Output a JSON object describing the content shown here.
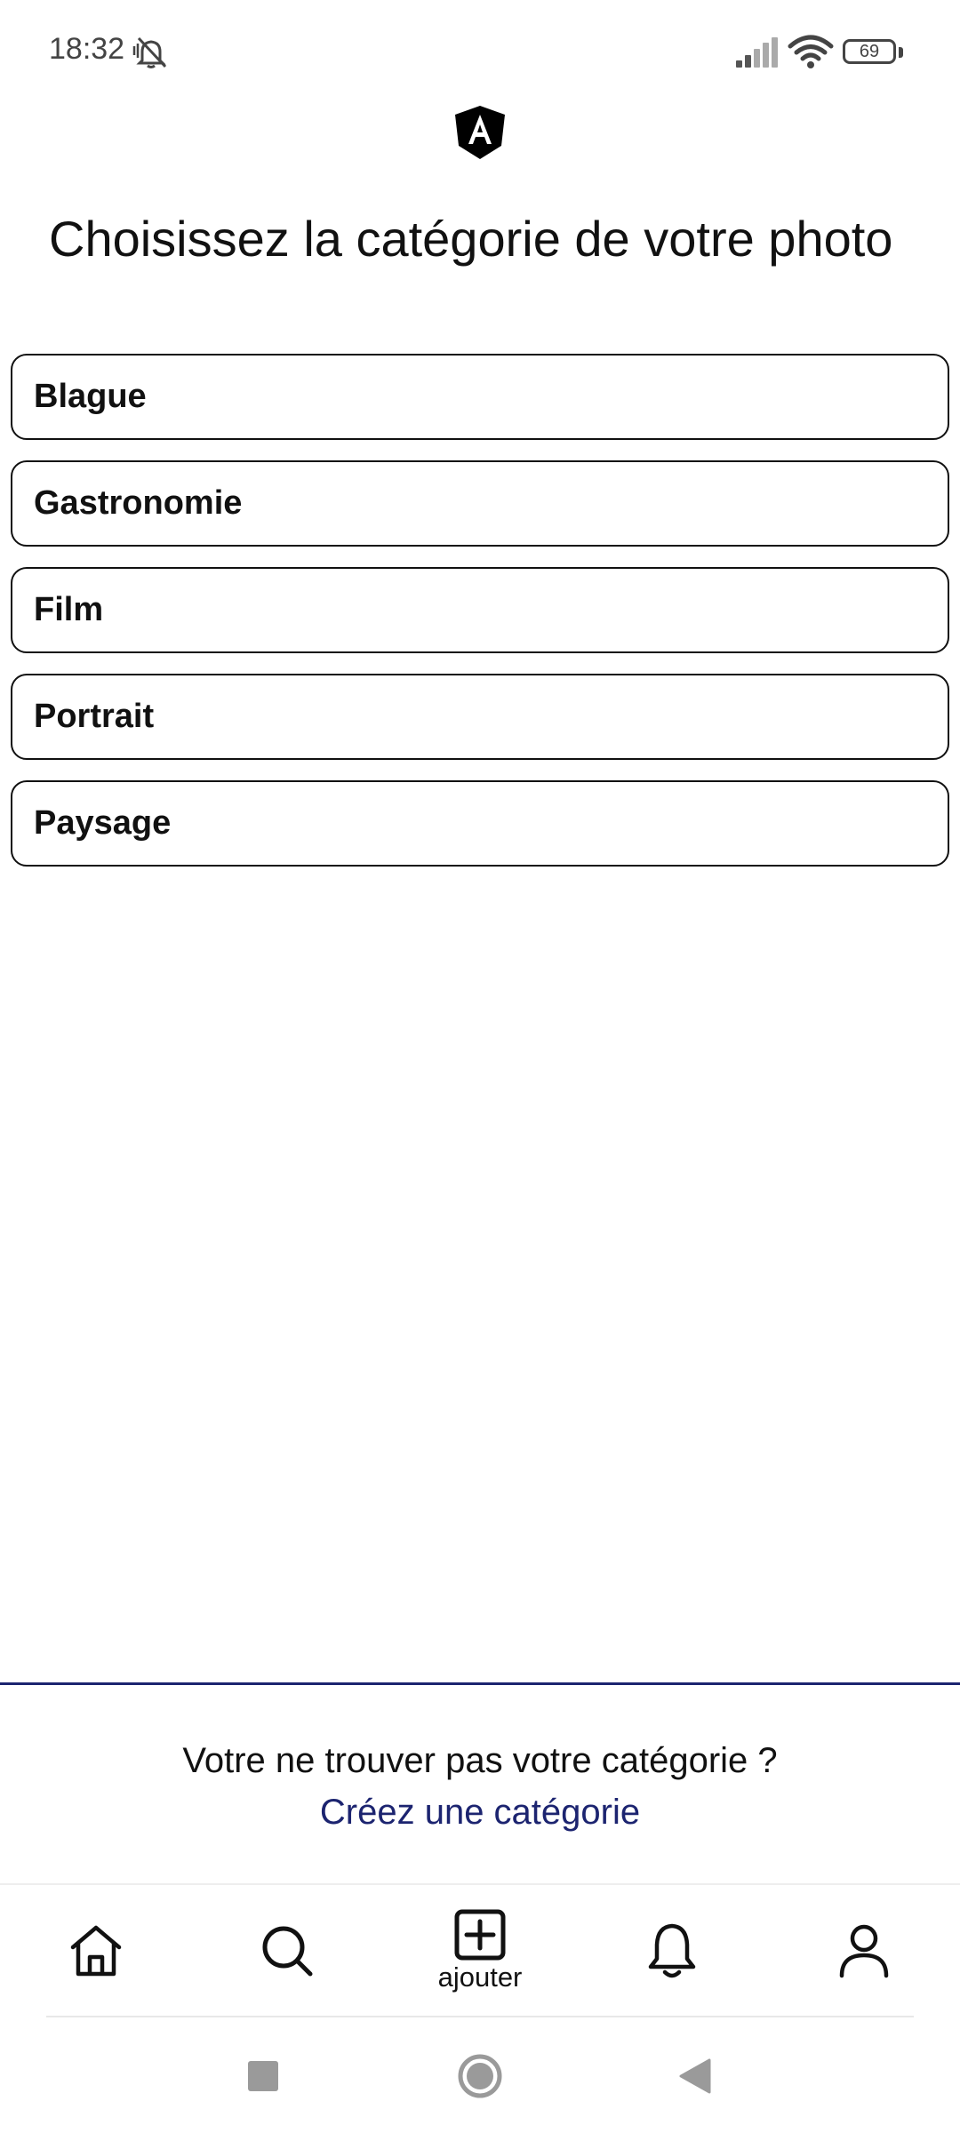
{
  "status_bar": {
    "time": "18:32",
    "battery_level": "69",
    "icons": [
      "mute-icon",
      "signal-icon",
      "wifi-icon",
      "battery-icon"
    ]
  },
  "header": {
    "logo_icon": "angular-logo-icon",
    "title": "Choisissez la catégorie de votre photo"
  },
  "categories": [
    {
      "label": "Blague"
    },
    {
      "label": "Gastronomie"
    },
    {
      "label": "Film"
    },
    {
      "label": "Portrait"
    },
    {
      "label": "Paysage"
    }
  ],
  "footer": {
    "question": "Votre ne trouver pas votre catégorie ?",
    "create_link": "Créez une catégorie"
  },
  "bottom_nav": {
    "items": [
      {
        "icon": "home-icon"
      },
      {
        "icon": "search-icon"
      },
      {
        "icon": "add-square-icon",
        "label": "ajouter"
      },
      {
        "icon": "bell-icon"
      },
      {
        "icon": "user-icon"
      }
    ]
  },
  "system_nav": {
    "buttons": [
      "recents-square-icon",
      "home-circle-icon",
      "back-triangle-icon"
    ]
  },
  "colors": {
    "accent": "#1c2470",
    "text": "#111111",
    "status_text": "#444444",
    "background": "#ffffff"
  }
}
